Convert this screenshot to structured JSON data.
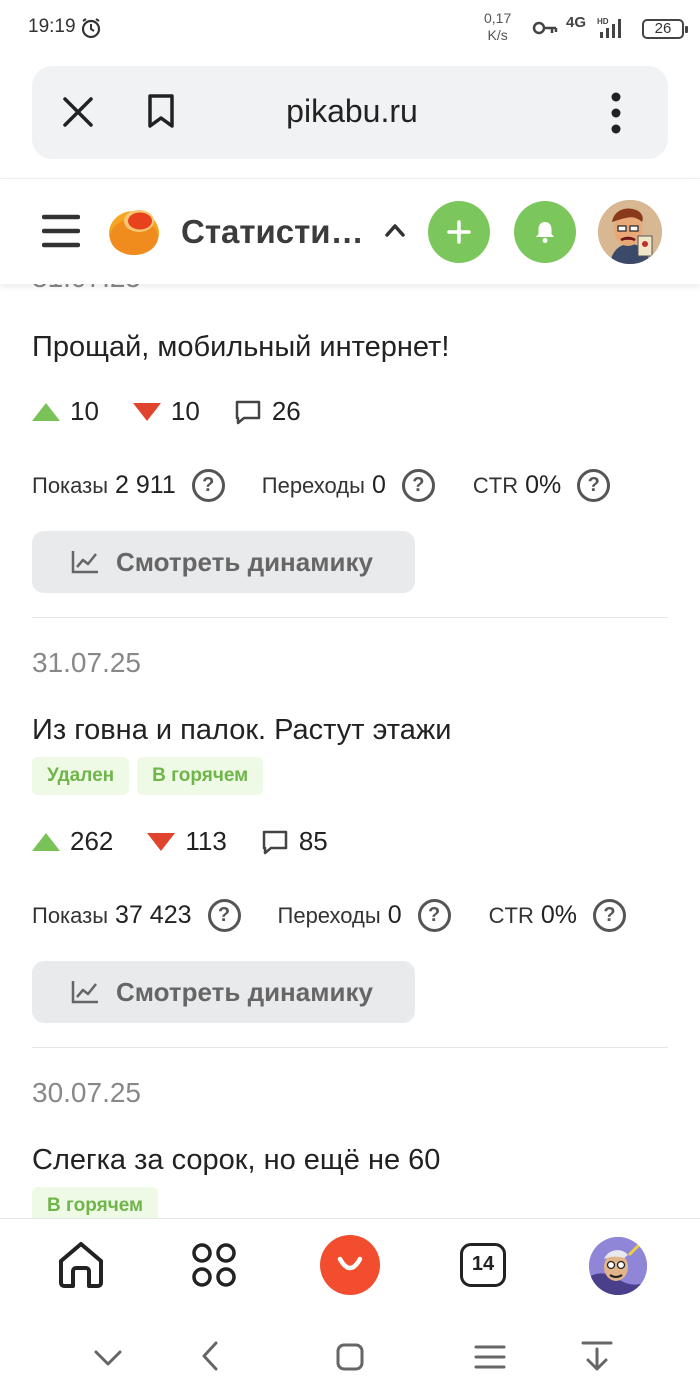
{
  "status_bar": {
    "time": "19:19",
    "net_speed_value": "0,17",
    "net_speed_unit": "K/s",
    "network": "4G",
    "battery": "26"
  },
  "browser": {
    "url": "pikabu.ru"
  },
  "header": {
    "title": "Статисти…"
  },
  "posts": [
    {
      "date": "31.07.25",
      "title": "Прощай, мобильный интернет!",
      "badges": [],
      "upvotes": "10",
      "downvotes": "10",
      "comments": "26",
      "stats": {
        "views_label": "Показы",
        "views": "2 911",
        "clicks_label": "Переходы",
        "clicks": "0",
        "ctr_label": "CTR",
        "ctr": "0%"
      },
      "dynamics_label": "Смотреть динамику"
    },
    {
      "date": "31.07.25",
      "title": "Из говна и палок. Растут этажи",
      "badges": [
        "Удален",
        "В горячем"
      ],
      "upvotes": "262",
      "downvotes": "113",
      "comments": "85",
      "stats": {
        "views_label": "Показы",
        "views": "37 423",
        "clicks_label": "Переходы",
        "clicks": "0",
        "ctr_label": "CTR",
        "ctr": "0%"
      },
      "dynamics_label": "Смотреть динамику"
    },
    {
      "date": "30.07.25",
      "title": "Слегка за сорок, но ещё не 60",
      "badges": [
        "В горячем"
      ]
    }
  ],
  "bottom_nav": {
    "tabs_count": "14"
  },
  "icons": {
    "help": "?"
  },
  "colors": {
    "accent_green": "#7bc75b",
    "upvote": "#78c257",
    "downvote": "#e0442f",
    "alice_red": "#f24d2e"
  }
}
